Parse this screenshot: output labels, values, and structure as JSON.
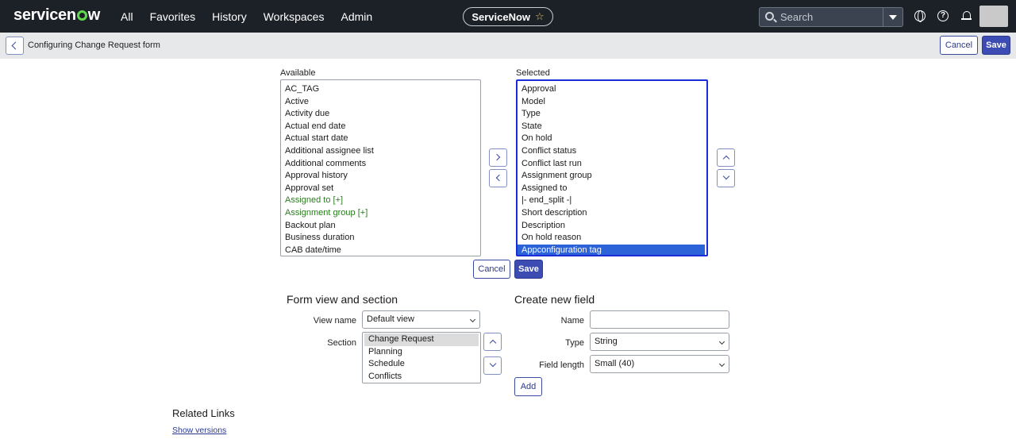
{
  "nav": {
    "logo": "servicenow",
    "items": [
      "All",
      "Favorites",
      "History",
      "Workspaces",
      "Admin"
    ],
    "instance_label": "ServiceNow",
    "search_placeholder": "Search"
  },
  "header": {
    "title": "Configuring Change Request form",
    "cancel_label": "Cancel",
    "save_label": "Save"
  },
  "slushbucket": {
    "available_label": "Available",
    "selected_label": "Selected",
    "available": [
      {
        "label": "AC_TAG"
      },
      {
        "label": "Active"
      },
      {
        "label": "Activity due"
      },
      {
        "label": "Actual end date"
      },
      {
        "label": "Actual start date"
      },
      {
        "label": "Additional assignee list"
      },
      {
        "label": "Additional comments"
      },
      {
        "label": "Approval history"
      },
      {
        "label": "Approval set"
      },
      {
        "label": "Assigned to [+]",
        "reference": true
      },
      {
        "label": "Assignment group [+]",
        "reference": true
      },
      {
        "label": "Backout plan"
      },
      {
        "label": "Business duration"
      },
      {
        "label": "CAB date/time"
      }
    ],
    "selected": [
      {
        "label": "Approval"
      },
      {
        "label": "Model"
      },
      {
        "label": "Type"
      },
      {
        "label": "State"
      },
      {
        "label": "On hold"
      },
      {
        "label": "Conflict status"
      },
      {
        "label": "Conflict last run"
      },
      {
        "label": "Assignment group"
      },
      {
        "label": "Assigned to"
      },
      {
        "label": "|- end_split -|"
      },
      {
        "label": "Short description"
      },
      {
        "label": "Description"
      },
      {
        "label": "On hold reason"
      },
      {
        "label": "Appconfiguration tag",
        "highlighted": true
      }
    ],
    "cancel_label": "Cancel",
    "save_label": "Save"
  },
  "form_view": {
    "heading": "Form view and section",
    "view_name_label": "View name",
    "view_name_value": "Default view",
    "section_label": "Section",
    "sections": [
      {
        "label": "Change Request",
        "highlighted": true
      },
      {
        "label": "Planning"
      },
      {
        "label": "Schedule"
      },
      {
        "label": "Conflicts"
      }
    ]
  },
  "create_field": {
    "heading": "Create new field",
    "name_label": "Name",
    "name_value": "",
    "type_label": "Type",
    "type_value": "String",
    "length_label": "Field length",
    "length_value": "Small (40)",
    "add_label": "Add"
  },
  "related": {
    "heading": "Related Links",
    "link": "Show versions"
  }
}
